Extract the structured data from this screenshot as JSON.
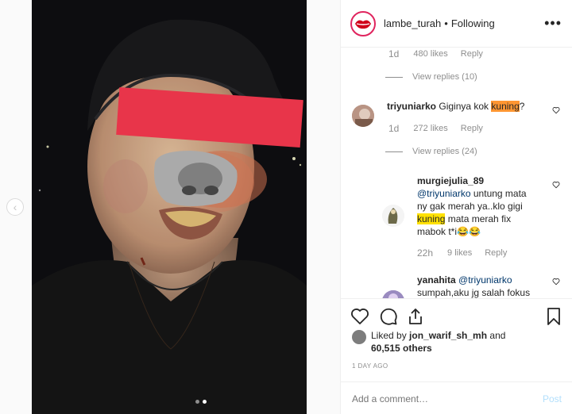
{
  "header": {
    "username": "lambe_turah",
    "separator": "•",
    "follow_state": "Following",
    "more": "•••"
  },
  "comments": {
    "top_meta": {
      "time": "1d",
      "likes": "480 likes",
      "reply": "Reply",
      "view_replies": "View replies (10)"
    },
    "c1": {
      "username": "triyuniarko",
      "text_before": "Giginya kok ",
      "highlight": "kuning",
      "text_after": "?",
      "time": "1d",
      "likes": "272 likes",
      "reply": "Reply",
      "view_replies": "View replies (24)"
    },
    "c2": {
      "username": "murgiejulia_89",
      "mention": "@triyuniarko",
      "text1": " untung mata ny gak merah ya..klo gigi ",
      "highlight": "kuning",
      "text2": " mata merah fix mabok t*i😂😂",
      "time": "22h",
      "likes": "9 likes",
      "reply": "Reply"
    },
    "c3": {
      "username": "yanahita",
      "mention": "@triyuniarko",
      "text": "sumpah,aku jg salah fokus"
    }
  },
  "actions": {
    "liked_prefix": "Liked by ",
    "liked_user": "jon_warif_sh_mh",
    "liked_and": " and",
    "others": "60,515 others",
    "date": "1 DAY AGO",
    "comment_placeholder": "Add a comment…",
    "post_label": "Post"
  },
  "icons": {
    "prev": "chevron-left-icon",
    "heart": "heart-icon",
    "comment": "comment-icon",
    "share": "share-icon",
    "save": "bookmark-icon"
  },
  "colors": {
    "censor_bar": "#e8354a",
    "mention": "#00376b",
    "highlight_orange": "#ff9632",
    "highlight_yellow": "#ffe100",
    "post_disabled": "#b2dffc"
  }
}
